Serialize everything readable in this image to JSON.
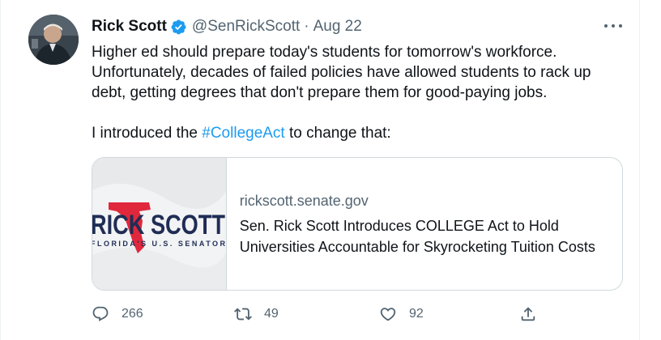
{
  "author": {
    "name": "Rick Scott",
    "handle": "@SenRickScott",
    "separator": "·",
    "date": "Aug 22",
    "verified": true
  },
  "tweet": {
    "paragraph1": "Higher ed should prepare today's students for tomorrow's workforce. Unfortunately, decades of failed policies have allowed students to rack up debt, getting degrees that don't prepare them for good-paying jobs.",
    "paragraph2_before": "I introduced the ",
    "hashtag": "#CollegeAct",
    "paragraph2_after": " to change that:"
  },
  "link_card": {
    "domain": "rickscott.senate.gov",
    "title": "Sen. Rick Scott Introduces COLLEGE Act to Hold Universities Accountable for Skyrocketing Tuition Costs",
    "image_logo_text": "RICK SCOTT",
    "image_logo_subtext": "FLORIDA'S U.S. SENATOR"
  },
  "actions": {
    "replies": "266",
    "retweets": "49",
    "likes": "92",
    "reply_icon": "reply-icon",
    "retweet_icon": "retweet-icon",
    "like_icon": "heart-icon",
    "share_icon": "share-icon"
  },
  "colors": {
    "link_blue": "#1d9bf0",
    "secondary_text": "#536471",
    "verified_blue": "#1d9bf0",
    "florida_red": "#e0283d"
  }
}
